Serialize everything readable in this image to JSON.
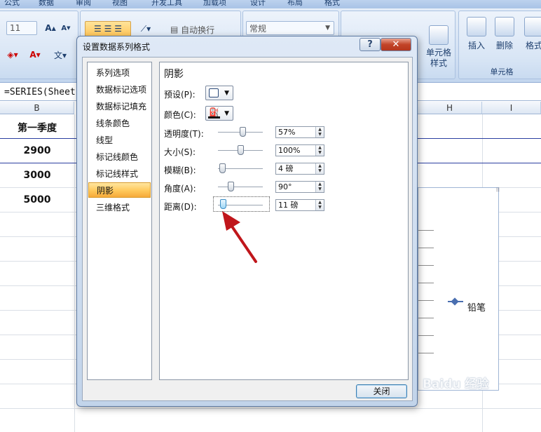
{
  "ribbon": {
    "tabs": [
      "公式",
      "数据",
      "审阅",
      "视图",
      "开发工具",
      "加载项",
      "设计",
      "布局",
      "格式"
    ],
    "font_size": "11",
    "wrap_text": "自动换行",
    "number_format": "常规",
    "cells_group_label": "单元格",
    "cell_style_label": "单元格\n样式",
    "insert": "插入",
    "delete": "删除",
    "format": "格式"
  },
  "formula": "=SERIES(Sheet",
  "columns": {
    "b": "B",
    "h": "H",
    "i": "I"
  },
  "cells": {
    "header": "第一季度",
    "r1": "2900",
    "r2": "3000",
    "r3": "5000"
  },
  "chart": {
    "legend_label": "铅笔"
  },
  "dialog": {
    "title": "设置数据系列格式",
    "help_symbol": "?",
    "close_symbol": "✕",
    "nav_items": [
      "系列选项",
      "数据标记选项",
      "数据标记填充",
      "线条颜色",
      "线型",
      "标记线颜色",
      "标记线样式",
      "阴影",
      "三维格式"
    ],
    "active_nav": "阴影",
    "section_title": "阴影",
    "preset_label": "预设(P):",
    "color_label": "颜色(C):",
    "properties": [
      {
        "label": "透明度(T):",
        "value": "57%",
        "level": 0.57
      },
      {
        "label": "大小(S):",
        "value": "100%",
        "level": 0.5
      },
      {
        "label": "模糊(B):",
        "value": "4 磅",
        "level": 0.04
      },
      {
        "label": "角度(A):",
        "value": "90°",
        "level": 0.25
      },
      {
        "label": "距离(D):",
        "value": "11 磅",
        "level": 0.05
      }
    ],
    "close_button": "关闭"
  },
  "watermark": "Baidu 经验"
}
